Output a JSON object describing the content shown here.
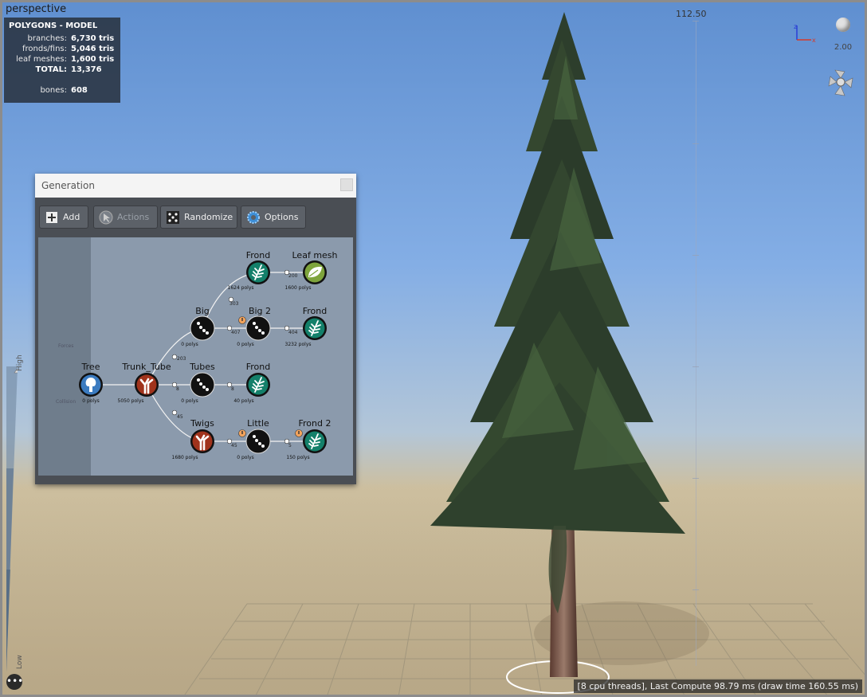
{
  "viewport": {
    "label": "perspective",
    "height_marker": "112.50",
    "camera_value": "2.00",
    "lod_high": "High",
    "lod_low": "Low",
    "status": "[8 cpu threads], Last Compute 98.79 ms (draw time 160.55 ms)"
  },
  "polygons": {
    "title": "POLYGONS - MODEL",
    "rows": [
      {
        "label": "branches:",
        "value": "6,730 tris"
      },
      {
        "label": "fronds/fins:",
        "value": "5,046 tris"
      },
      {
        "label": "leaf meshes:",
        "value": "1,600 tris"
      },
      {
        "label": "TOTAL:",
        "value": "13,376"
      }
    ],
    "bones_label": "bones:",
    "bones_value": "608"
  },
  "generation": {
    "title": "Generation",
    "toolbar": {
      "add": "Add",
      "actions": "Actions",
      "randomize": "Randomize",
      "options": "Options"
    },
    "ghost": {
      "forces": "Forces",
      "collision": "Collision"
    },
    "nodes": {
      "tree": {
        "label": "Tree",
        "polys": "0 polys"
      },
      "trunk": {
        "label": "Trunk_Tube",
        "polys": "5050 polys"
      },
      "big": {
        "label": "Big",
        "polys": "0 polys"
      },
      "tubes": {
        "label": "Tubes",
        "polys": "0 polys"
      },
      "twigs": {
        "label": "Twigs",
        "polys": "1680 polys"
      },
      "frond_top": {
        "label": "Frond",
        "polys": "1624 polys"
      },
      "big2": {
        "label": "Big 2",
        "polys": "0 polys"
      },
      "frond_mid": {
        "label": "Frond",
        "polys": "40 polys"
      },
      "little": {
        "label": "Little",
        "polys": "0 polys"
      },
      "leaf_mesh": {
        "label": "Leaf mesh",
        "polys": "1600 polys"
      },
      "frond_big2": {
        "label": "Frond",
        "polys": "3232 polys"
      },
      "frond2": {
        "label": "Frond 2",
        "polys": "150 polys"
      }
    },
    "edges": {
      "e1": "203",
      "e2": "303",
      "e3": "407",
      "e4": "200",
      "e5": "404",
      "e6": "8",
      "e7": "8",
      "e8": "45",
      "e9": "45",
      "e10": "5"
    }
  },
  "colors": {
    "branch_node": "#a0331c",
    "frond_node": "#14806a",
    "leaf_node": "#7ea43c",
    "tree_node": "#3b7bc0",
    "dark_node": "#111111"
  }
}
